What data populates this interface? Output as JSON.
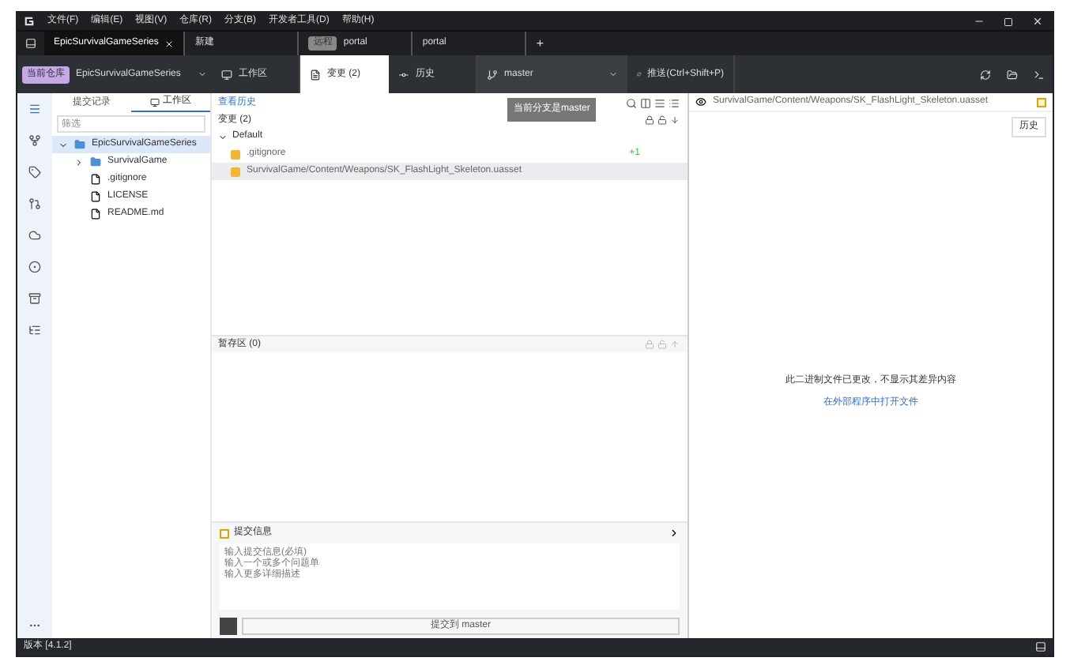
{
  "menu": [
    "文件(F)",
    "编辑(E)",
    "视图(V)",
    "仓库(R)",
    "分支(B)",
    "开发者工具(D)",
    "帮助(H)"
  ],
  "tabs": [
    {
      "label": "EpicSurvivalGameSeries",
      "selected": true,
      "closable": true
    },
    {
      "label": "新建",
      "selected": false,
      "closable": false
    },
    {
      "label": "portal",
      "badge": "远程",
      "selected": false,
      "closable": false
    },
    {
      "label": "portal",
      "selected": false,
      "closable": false
    }
  ],
  "new_tab": "+",
  "toolbar": {
    "repo_badge": "当前仓库",
    "repo": "EpicSurvivalGameSeries",
    "views": [
      {
        "label": "工作区",
        "selected": false
      },
      {
        "label": "变更 (2)",
        "selected": true
      },
      {
        "label": "历史",
        "selected": false
      }
    ],
    "branch": "master",
    "action": "推送(Ctrl+Shift+P)"
  },
  "tooltip": "当前分支是master",
  "left_panel": {
    "tabs": [
      {
        "label": "提交记录",
        "selected": false
      },
      {
        "label": "工作区",
        "selected": true
      }
    ],
    "filter": {
      "placeholder": "筛选"
    },
    "tree": [
      {
        "name": "EpicSurvivalGameSeries",
        "kind": "folder",
        "expanded": true,
        "selected": true,
        "children": [
          {
            "name": "SurvivalGame",
            "kind": "folder",
            "expanded": false,
            "selected": false
          },
          {
            "name": ".gitignore",
            "kind": "file",
            "selected": false
          },
          {
            "name": "LICENSE",
            "kind": "file",
            "selected": false
          },
          {
            "name": "README.md",
            "kind": "file",
            "selected": false
          }
        ]
      }
    ]
  },
  "changes": {
    "link": "查看历史",
    "header": "变更 (2)",
    "group": "Default",
    "files": [
      {
        "path": ".gitignore",
        "stat": "+1",
        "selected": false
      },
      {
        "path": "SurvivalGame/Content/Weapons/SK_FlashLight_Skeleton.uasset",
        "selected": true
      }
    ]
  },
  "staged": {
    "header": "暂存区 (0)"
  },
  "commit": {
    "header": "提交信息",
    "lines": [
      "输入提交信息(必填)",
      "输入一个或多个问题单",
      "输入更多详细描述"
    ],
    "button": "提交到 master"
  },
  "diff": {
    "path": "SurvivalGame/Content/Weapons/SK_FlashLight_Skeleton.uasset",
    "history_button": "历史",
    "message": "此二进制文件已更改，不显示其差异内容",
    "link": "在外部程序中打开文件"
  },
  "status_bar": {
    "version": "版本 [4.1.2]"
  }
}
